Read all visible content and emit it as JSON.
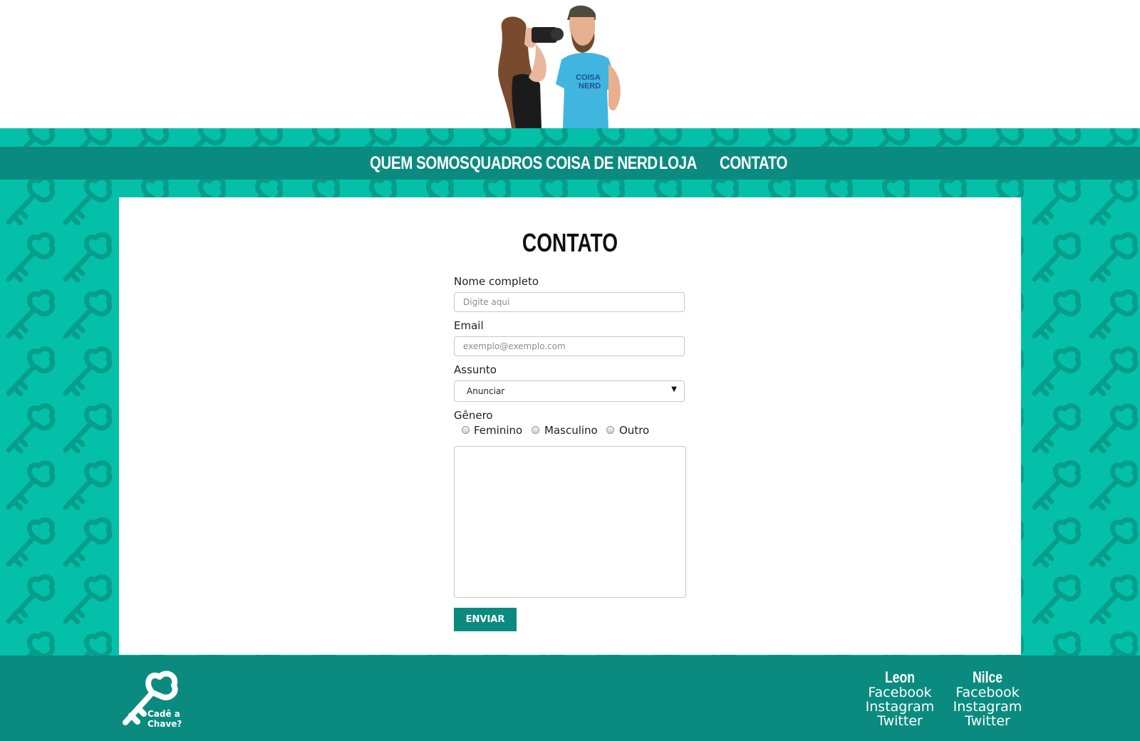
{
  "nav": {
    "items": [
      "QUEM SOMOS",
      "QUADROS",
      "COISA DE NERD",
      "LOJA",
      "CONTATO"
    ]
  },
  "main": {
    "title": "CONTATO",
    "form": {
      "name_label": "Nome completo",
      "name_placeholder": "Digite aqui",
      "email_label": "Email",
      "email_placeholder": "exemplo@exemplo.com",
      "subject_label": "Assunto",
      "subject_value": "Anunciar",
      "gender_label": "Gênero",
      "gender_options": [
        "Feminino",
        "Masculino",
        "Outro"
      ],
      "submit_label": "ENVIAR"
    }
  },
  "footer": {
    "logo_text": [
      "Cadê a",
      "Chave?"
    ],
    "columns": [
      {
        "name": "Leon",
        "links": [
          "Facebook",
          "Instagram",
          "Twitter"
        ]
      },
      {
        "name": "Nilce",
        "links": [
          "Facebook",
          "Instagram",
          "Twitter"
        ]
      }
    ]
  },
  "colors": {
    "background_teal": "#04c0a9",
    "pattern_teal": "#069e8a",
    "nav_dark_teal": "#0b8b80",
    "panel_white": "#ffffff"
  },
  "icons": {
    "hero": "hosts-illustration",
    "logo": "key-logo-icon",
    "select_arrow": "dropdown-arrow-icon"
  }
}
